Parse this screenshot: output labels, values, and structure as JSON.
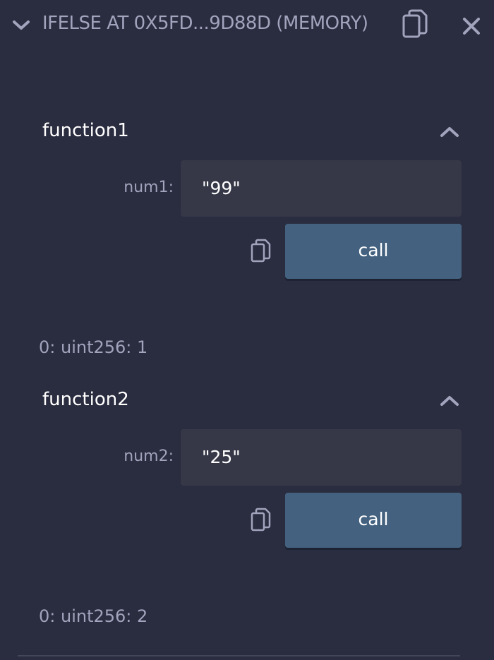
{
  "header": {
    "title": "IFELSE AT 0X5FD...9D88D (MEMORY)",
    "collapse_icon": "chevron-down-icon",
    "copy_icon": "copy-icon",
    "close_icon": "close-icon"
  },
  "functions": [
    {
      "name": "function1",
      "param_label": "num1:",
      "param_value": "\"99\"",
      "button_label": "call",
      "result": "0: uint256: 1"
    },
    {
      "name": "function2",
      "param_label": "num2:",
      "param_value": "\"25\"",
      "button_label": "call",
      "result": "0: uint256: 2"
    }
  ],
  "colors": {
    "background": "#2a2c3f",
    "input_bg": "#363848",
    "button_bg": "#44627f",
    "text_muted": "#a2a3bd",
    "text_bright": "#ffffff"
  }
}
